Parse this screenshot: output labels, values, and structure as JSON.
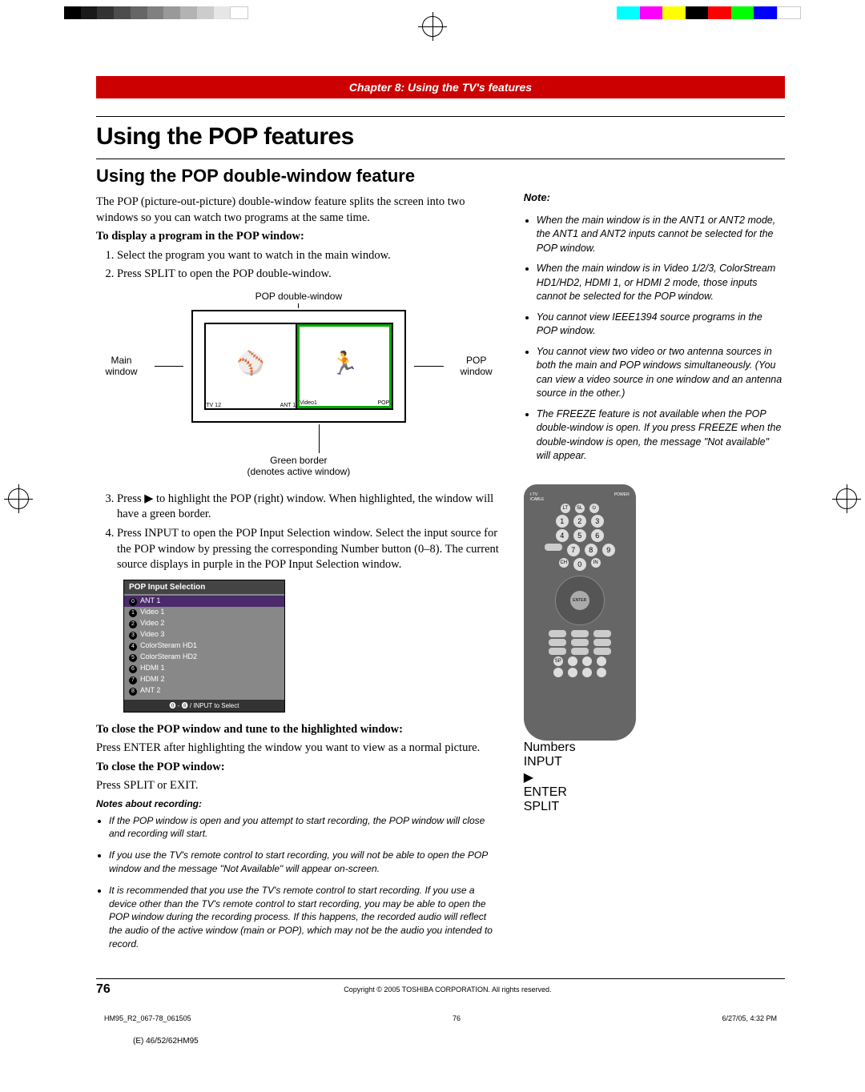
{
  "chapter": "Chapter 8: Using the TV's features",
  "h1": "Using the POP features",
  "h2": "Using the POP double-window feature",
  "intro": "The POP (picture-out-picture) double-window feature splits the screen into two windows so you can watch two programs at the same time.",
  "display_head": "To display a program in the POP window:",
  "steps12": {
    "s1": "Select the program you want to watch in the main window.",
    "s2": "Press SPLIT to open the POP double-window."
  },
  "diagram": {
    "top": "POP double-window",
    "main_window": "Main window",
    "pop_window": "POP window",
    "ant1": "ANT 1",
    "tv12": "TV 12",
    "video1": "Video1",
    "pop": "POP",
    "green1": "Green border",
    "green2": "(denotes active window)"
  },
  "steps34": {
    "s3": "Press ▶ to highlight the POP (right) window. When highlighted, the window will have a green border.",
    "s4": "Press INPUT to open the POP Input Selection window. Select the input source for the POP window by pressing the corresponding Number button (0–8). The current source displays in purple in the POP Input Selection window."
  },
  "input_sel": {
    "title": "POP Input Selection",
    "items": [
      "ANT 1",
      "Video 1",
      "Video 2",
      "Video 3",
      "ColorSteram HD1",
      "ColorSteram HD2",
      "HDMI 1",
      "HDMI 2",
      "ANT 2"
    ],
    "footer": "⓿ - ❽ / INPUT to Select"
  },
  "close1_head": "To close the POP window and tune to the highlighted window:",
  "close1_body": "Press ENTER after highlighting the window you want to view as a normal picture.",
  "close2_head": "To close the POP window:",
  "close2_body": "Press SPLIT or EXIT.",
  "rec_head": "Notes about recording:",
  "rec_notes": [
    "If the POP window is open and you attempt to start recording, the POP window will close and recording will start.",
    "If you use the TV's remote control to start recording, you will not be able to open the POP window and the message \"Not Available\" will appear on-screen.",
    "It is recommended that you use the TV's remote control to start recording. If you use a device other than the TV's remote control to start recording, you may be able to open the POP window during the recording process. If this happens, the recorded audio will reflect the audio of the active window (main or POP), which may not be the audio you intended to record."
  ],
  "side_note_head": "Note:",
  "side_notes": [
    "When the main window is in the ANT1 or ANT2 mode, the ANT1 and ANT2 inputs cannot be selected for the POP window.",
    "When the main window is in Video 1/2/3, ColorStream HD1/HD2, HDMI 1, or HDMI 2 mode, those inputs cannot be selected for the POP window.",
    "You cannot view IEEE1394 source programs in the POP window.",
    "You cannot view two video or two antenna sources in both the main and POP windows simultaneously. (You can view a video source in one window and an antenna source in the other.)",
    "The FREEZE feature is not available when the POP double-window is open. If you press FREEZE when the double-window is open, the message \"Not available\" will appear."
  ],
  "remote_labels": {
    "numbers": "Numbers",
    "input": "INPUT",
    "right": "▶",
    "enter": "ENTER",
    "split": "SPLIT"
  },
  "page_number": "76",
  "copyright": "Copyright © 2005 TOSHIBA CORPORATION. All rights reserved.",
  "file_id": "HM95_R2_067-78_061505",
  "sheet_num": "76",
  "timestamp": "6/27/05, 4:32 PM",
  "model": "(E) 46/52/62HM95",
  "colorbar_left": [
    "#000",
    "#333",
    "#555",
    "#777",
    "#999",
    "#bbb",
    "#fff",
    "#fff",
    "#fff",
    "#fff",
    "#fff",
    "#fff",
    "#fff"
  ],
  "colorbar_right": [
    "#0ff",
    "#f0f",
    "#ff0",
    "#000",
    "#f00",
    "#0f0",
    "#00f",
    "#fff"
  ]
}
